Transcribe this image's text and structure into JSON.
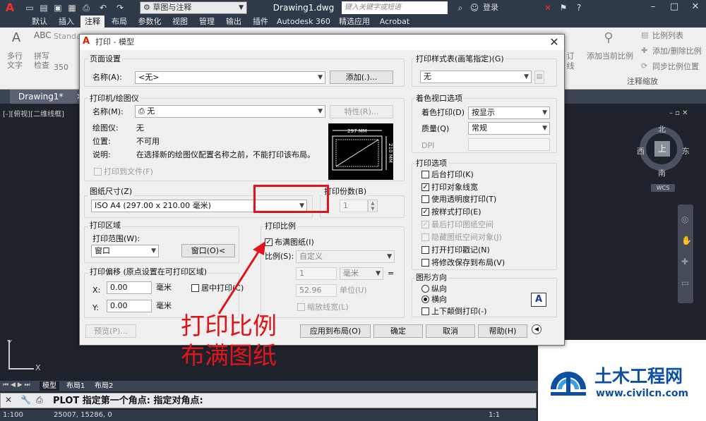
{
  "titlebar": {
    "workspace": "草图与注释",
    "document_title": "Drawing1.dwg",
    "search_placeholder": "键入关键字或短语",
    "login": "登录"
  },
  "ribbon_tabs": [
    "默认",
    "插入",
    "注释",
    "布局",
    "参数化",
    "视图",
    "管理",
    "输出",
    "插件",
    "Autodesk 360",
    "精选应用",
    "Acrobat"
  ],
  "active_ribbon_tab": "注释",
  "ribbon": {
    "text_label": "多行\n文字",
    "spell_label": "拼写\n检查",
    "style_combo": "Standa",
    "height_value": "350",
    "add_scale": "添加当前比例",
    "scale_list": "比例列表",
    "add_delete_scale": "添加/删除比例",
    "sync_scale": "同步比例位置",
    "panel_title": "注释缩放",
    "partial_label_1": "订",
    "partial_label_2": "线"
  },
  "doc_tab": "Drawing1*",
  "viewport_label": "[-][俯视][二维线框]",
  "viewcube": {
    "n": "北",
    "s": "南",
    "w": "西",
    "e": "东",
    "top": "上",
    "wcs": "WCS"
  },
  "layout_tabs": [
    "模型",
    "布局1",
    "布局2"
  ],
  "command_line": "PLOT 指定第一个角点: 指定对角点:",
  "status_bar": {
    "scale": "1:100",
    "coords": "25007, 15286, 0",
    "zoom": "1:1"
  },
  "dialog": {
    "title": "打印 - 模型",
    "page_setup": {
      "group": "页面设置",
      "name_label": "名称(A):",
      "name_value": "<无>",
      "add_button": "添加(.)..."
    },
    "printer": {
      "group": "打印机/绘图仪",
      "name_label": "名称(M):",
      "name_value": "无",
      "properties_button": "特性(R)...",
      "plotter_label": "绘图仪:",
      "plotter_value": "无",
      "location_label": "位置:",
      "location_value": "不可用",
      "description_label": "说明:",
      "description_value": "在选择新的绘图仪配置名称之前，不能打印该布局。",
      "print_to_file": "打印到文件(F)",
      "preview_width": "297 MM",
      "preview_height": "210 MM"
    },
    "paper_size": {
      "group": "图纸尺寸(Z)",
      "value": "ISO A4 (297.00 x 210.00 毫米)"
    },
    "copies": {
      "group": "打印份数(B)",
      "value": "1"
    },
    "plot_area": {
      "group": "打印区域",
      "range_label": "打印范围(W):",
      "range_value": "窗口",
      "window_button": "窗口(O)<"
    },
    "plot_offset": {
      "group": "打印偏移 (原点设置在可打印区域)",
      "x_label": "X:",
      "x_value": "0.00",
      "y_label": "Y:",
      "y_value": "0.00",
      "unit": "毫米",
      "center": "居中打印(C)"
    },
    "plot_scale": {
      "group": "打印比例",
      "fit_paper": "布满图纸(I)",
      "fit_checked": true,
      "scale_label": "比例(S):",
      "scale_value": "自定义",
      "value1": "1",
      "unit_value": "毫米",
      "equals": "=",
      "value2": "52.96",
      "unit2": "单位(U)",
      "scale_lineweights": "缩放线宽(L)"
    },
    "plot_style": {
      "group": "打印样式表(画笔指定)(G)",
      "value": "无"
    },
    "shaded_viewport": {
      "group": "着色视口选项",
      "shade_label": "着色打印(D)",
      "shade_value": "按显示",
      "quality_label": "质量(Q)",
      "quality_value": "常规",
      "dpi_label": "DPI"
    },
    "plot_options": {
      "group": "打印选项",
      "items": [
        {
          "label": "后台打印(K)",
          "checked": false,
          "enabled": true
        },
        {
          "label": "打印对象线宽",
          "checked": true,
          "enabled": true
        },
        {
          "label": "使用透明度打印(T)",
          "checked": false,
          "enabled": true
        },
        {
          "label": "按样式打印(E)",
          "checked": true,
          "enabled": true
        },
        {
          "label": "最后打印图纸空间",
          "checked": true,
          "enabled": false
        },
        {
          "label": "隐藏图纸空间对象(J)",
          "checked": false,
          "enabled": false
        },
        {
          "label": "打开打印戳记(N)",
          "checked": false,
          "enabled": true
        },
        {
          "label": "将修改保存到布局(V)",
          "checked": false,
          "enabled": true
        }
      ]
    },
    "orientation": {
      "group": "图形方向",
      "portrait": "纵向",
      "landscape": "横向",
      "upside_down": "上下颠倒打印(-)",
      "icon": "A"
    },
    "buttons": {
      "preview": "预览(P)...",
      "apply_layout": "应用到布局(O)",
      "ok": "确定",
      "cancel": "取消",
      "help": "帮助(H)"
    }
  },
  "annotation": {
    "line1": "打印比例",
    "line2": "布满图纸",
    "color": "#e0141a"
  },
  "watermark": {
    "name": "土木工程网",
    "url": "www.civilcn.com"
  }
}
